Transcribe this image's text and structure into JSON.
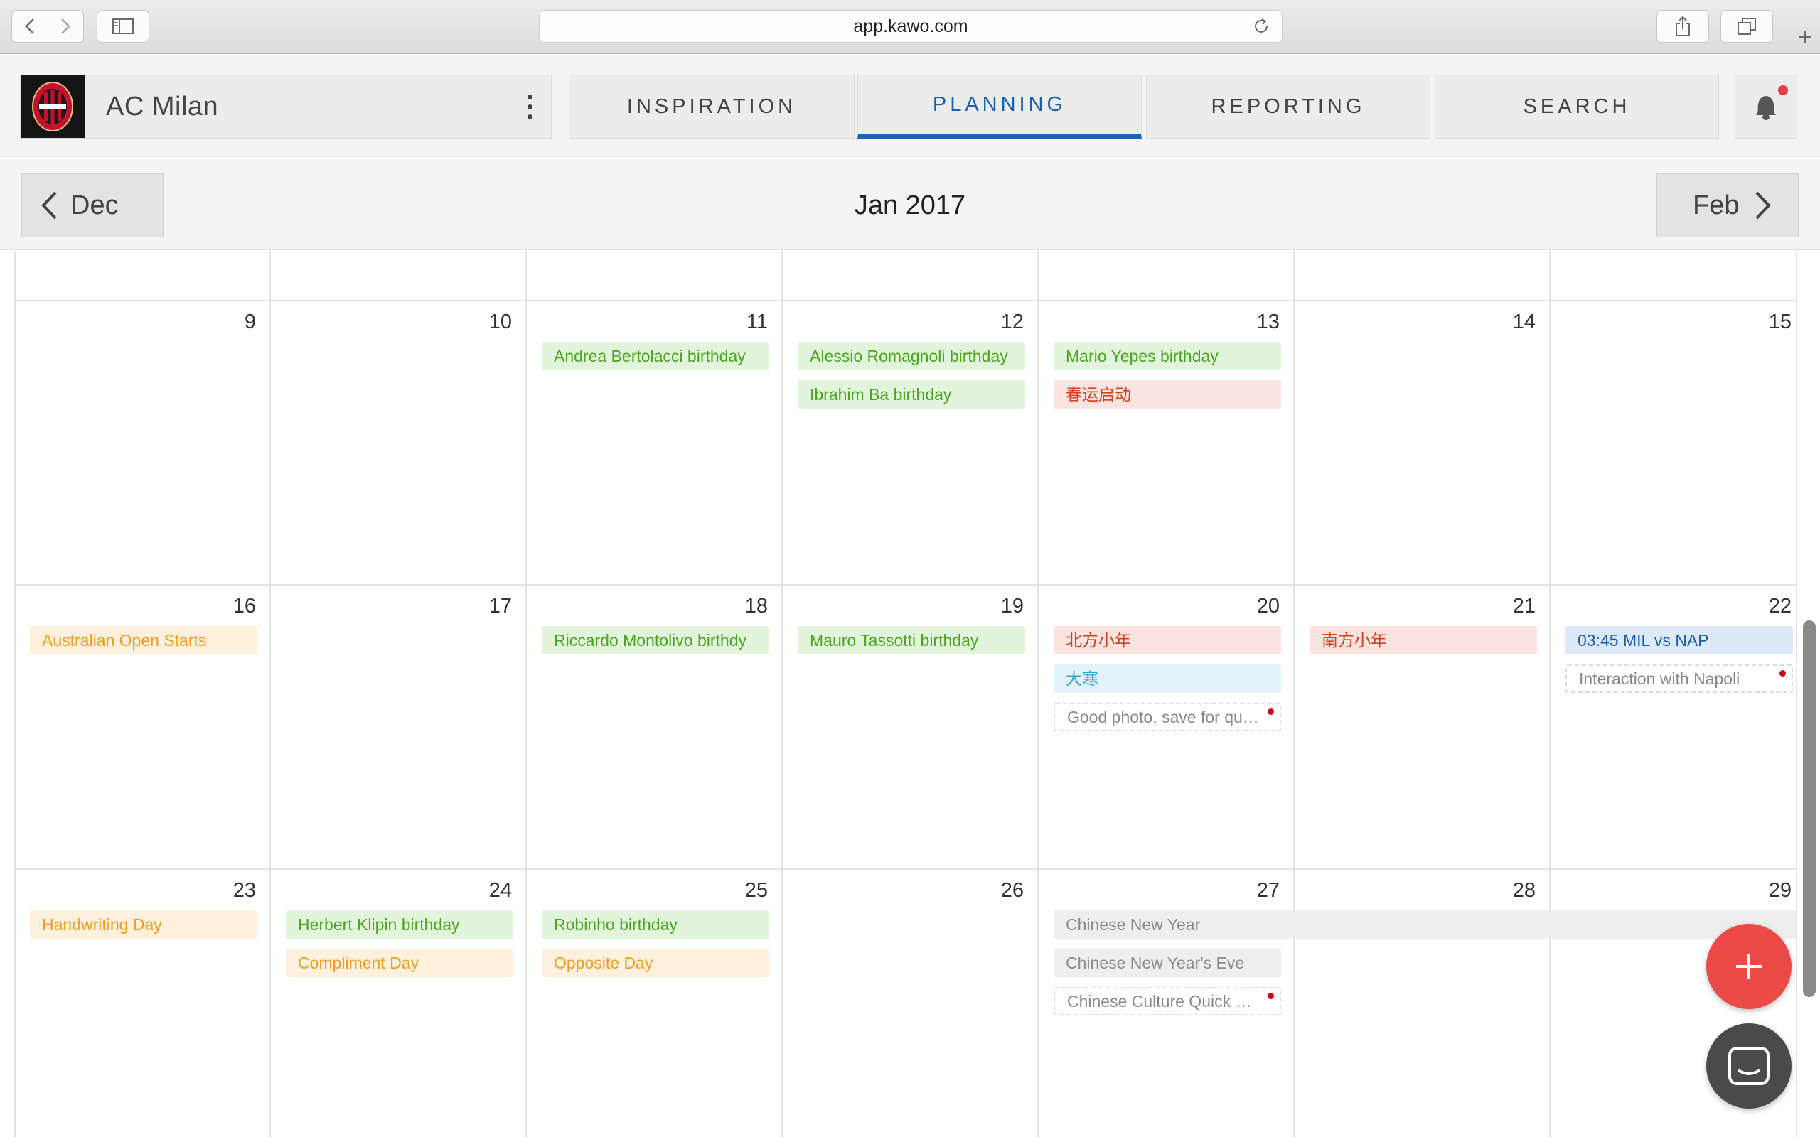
{
  "browser": {
    "url": "app.kawo.com"
  },
  "header": {
    "team_name": "AC Milan",
    "logo_name": "ac-milan-crest",
    "tabs": [
      {
        "label": "INSPIRATION",
        "active": false
      },
      {
        "label": "PLANNING",
        "active": true
      },
      {
        "label": "REPORTING",
        "active": false
      },
      {
        "label": "SEARCH",
        "active": false
      }
    ],
    "accent_color": "#1565c0",
    "notification_color": "#e8403c"
  },
  "month_nav": {
    "prev_label": "Dec",
    "title": "Jan 2017",
    "next_label": "Feb"
  },
  "calendar": {
    "weeks": [
      {
        "days": [
          {
            "num": "9",
            "events": []
          },
          {
            "num": "10",
            "events": []
          },
          {
            "num": "11",
            "events": [
              {
                "text": "Andrea Bertolacci birthday",
                "type": "green"
              }
            ]
          },
          {
            "num": "12",
            "events": [
              {
                "text": "Alessio Romagnoli birthday",
                "type": "green"
              },
              {
                "text": "Ibrahim Ba birthday",
                "type": "green"
              }
            ]
          },
          {
            "num": "13",
            "events": [
              {
                "text": "Mario Yepes birthday",
                "type": "green"
              },
              {
                "text": "春运启动",
                "type": "red"
              }
            ]
          },
          {
            "num": "14",
            "events": []
          },
          {
            "num": "15",
            "events": []
          }
        ]
      },
      {
        "days": [
          {
            "num": "16",
            "events": [
              {
                "text": "Australian Open Starts",
                "type": "orange"
              }
            ]
          },
          {
            "num": "17",
            "events": []
          },
          {
            "num": "18",
            "events": [
              {
                "text": "Riccardo Montolivo birthdy",
                "type": "green"
              }
            ]
          },
          {
            "num": "19",
            "events": [
              {
                "text": "Mauro Tassotti birthday",
                "type": "green"
              }
            ]
          },
          {
            "num": "20",
            "events": [
              {
                "text": "北方小年",
                "type": "red"
              },
              {
                "text": "大寒",
                "type": "blue"
              },
              {
                "text": "Good photo, save for quo...",
                "type": "note"
              }
            ]
          },
          {
            "num": "21",
            "events": [
              {
                "text": "南方小年",
                "type": "red"
              }
            ]
          },
          {
            "num": "22",
            "events": [
              {
                "text": "03:45 MIL vs NAP",
                "type": "navy"
              },
              {
                "text": "Interaction with Napoli",
                "type": "note"
              }
            ]
          }
        ]
      },
      {
        "days": [
          {
            "num": "23",
            "events": [
              {
                "text": "Handwriting Day",
                "type": "orange"
              }
            ]
          },
          {
            "num": "24",
            "events": [
              {
                "text": "Herbert Klipin birthday",
                "type": "green"
              },
              {
                "text": "Compliment Day",
                "type": "orange"
              }
            ]
          },
          {
            "num": "25",
            "events": [
              {
                "text": "Robinho birthday",
                "type": "green"
              },
              {
                "text": "Opposite Day",
                "type": "orange"
              }
            ]
          },
          {
            "num": "26",
            "events": []
          },
          {
            "num": "27",
            "events": [
              {
                "text": "Chinese New Year",
                "type": "gray"
              },
              {
                "text": "Chinese New Year's Eve",
                "type": "gray"
              },
              {
                "text": "Chinese Culture Quick Qu...",
                "type": "note"
              }
            ]
          },
          {
            "num": "28",
            "events": []
          },
          {
            "num": "29",
            "events": []
          }
        ]
      }
    ]
  },
  "colors": {
    "green_text": "#4aa51f",
    "green_bg": "#e2f5dc",
    "red_text": "#d2421f",
    "red_bg": "#fbe3df",
    "orange_text": "#f19c1b",
    "orange_bg": "#fdf0dc",
    "blue_text": "#2ca6db",
    "navy_text": "#1d5fac",
    "fab": "#ec4a47"
  },
  "icons": {
    "fab": "plus-icon",
    "chat": "chat-icon"
  }
}
